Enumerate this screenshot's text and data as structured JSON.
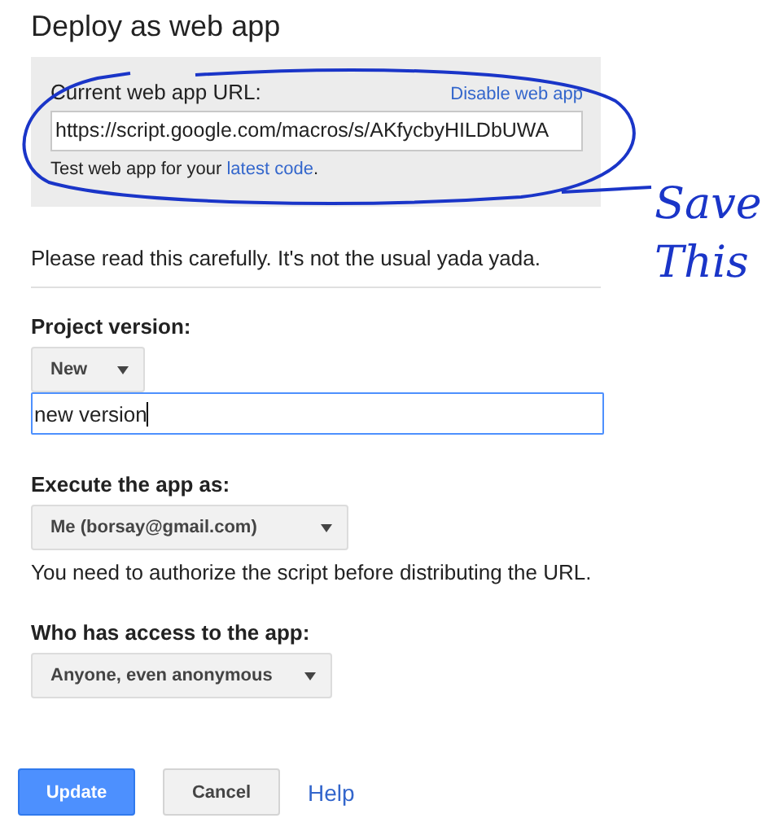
{
  "title": "Deploy as web app",
  "current_url": {
    "label": "Current web app URL:",
    "disable_link": "Disable web app",
    "value": "https://script.google.com/macros/s/AKfycbyHILDbUWA",
    "note": "Test web app for your ",
    "note_link": "latest code",
    "note_end": "."
  },
  "notice": "Please read this carefully. It's not the usual yada yada.",
  "project_version": {
    "label": "Project version:",
    "select": "New",
    "description": {
      "value": "new version",
      "focused": true
    }
  },
  "execute_as": {
    "label": "Execute the app as:",
    "select": "Me (borsay@gmail.com)",
    "hint": "You need to authorize the script before distributing the URL."
  },
  "access": {
    "label": "Who has access to the app:",
    "select": "Anyone, even anonymous"
  },
  "buttons": [
    {
      "label": "Update",
      "kind": "primary"
    },
    {
      "label": "Cancel",
      "kind": "secondary"
    },
    {
      "label": "Help",
      "kind": "link"
    }
  ],
  "annotation": {
    "lines": [
      "Save",
      "This"
    ]
  }
}
